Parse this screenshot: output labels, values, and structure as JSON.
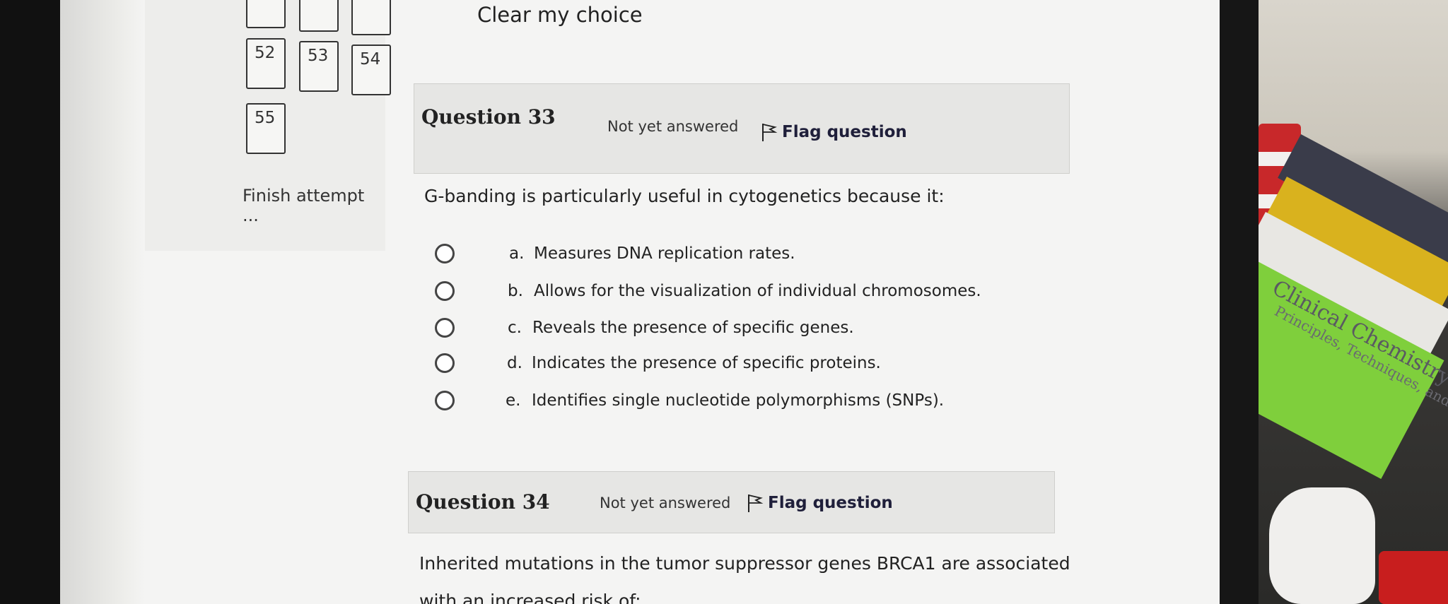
{
  "nav": {
    "numbers": [
      "52",
      "53",
      "54",
      "55"
    ],
    "finish_label": "Finish attempt ..."
  },
  "clear_choice": "Clear my choice",
  "question33": {
    "title_prefix": "Question ",
    "number": "33",
    "status": "Not yet answered",
    "flag_label": "Flag question",
    "text": "G-banding is particularly useful in cytogenetics because it:",
    "options": [
      {
        "letter": "a.",
        "text": "Measures DNA replication rates."
      },
      {
        "letter": "b.",
        "text": "Allows for the visualization of individual chromosomes."
      },
      {
        "letter": "c.",
        "text": "Reveals the presence of specific genes."
      },
      {
        "letter": "d.",
        "text": "Indicates the presence of specific proteins."
      },
      {
        "letter": "e.",
        "text": "Identifies single nucleotide polymorphisms (SNPs)."
      }
    ]
  },
  "question34": {
    "title_prefix": "Question ",
    "number": "34",
    "status": "Not yet answered",
    "flag_label": "Flag question",
    "text_line1": "Inherited mutations in the tumor suppressor genes BRCA1 are associated",
    "text_line2": "with an increased risk of:"
  },
  "background": {
    "book_title": "Clinical Chemistry",
    "book_subtitle": "Principles, Techniques, and Correl"
  }
}
